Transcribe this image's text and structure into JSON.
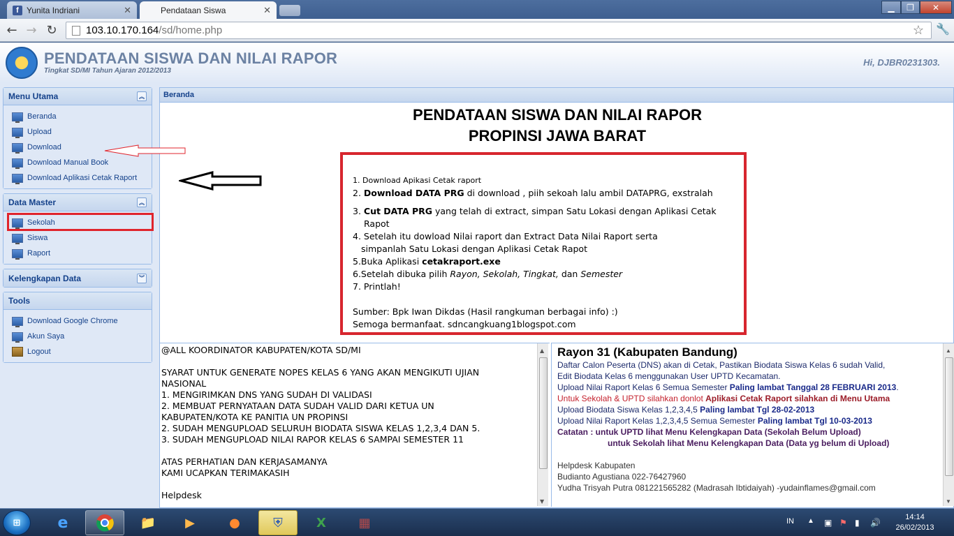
{
  "browser": {
    "tabs": [
      {
        "label": "Yunita Indriani",
        "icon": "facebook-icon"
      },
      {
        "label": "Pendataan Siswa",
        "icon": "page-icon"
      }
    ],
    "url_host": "103.10.170.164",
    "url_path": "/sd/home.php"
  },
  "header": {
    "title": "PENDATAAN SISWA DAN NILAI RAPOR",
    "subtitle": "Tingkat SD/MI Tahun Ajaran 2012/2013",
    "greeting": "Hi, DJBR0231303."
  },
  "sidebar": {
    "panels": [
      {
        "title": "Menu Utama",
        "items": [
          "Beranda",
          "Upload",
          "Download",
          "Download Manual Book",
          "Download Aplikasi Cetak Raport"
        ]
      },
      {
        "title": "Data Master",
        "items": [
          "Sekolah",
          "Siswa",
          "Raport"
        ]
      },
      {
        "title": "Kelengkapan Data",
        "items": []
      },
      {
        "title": "Tools",
        "items": [
          "Download Google Chrome",
          "Akun Saya",
          "Logout"
        ]
      }
    ]
  },
  "main": {
    "tab_title": "Beranda",
    "hero_line1": "PENDATAAN SISWA DAN NILAI RAPOR",
    "hero_line2": "PROPINSI JAWA BARAT",
    "instructions": {
      "l1": "1. Download Apikasi Cetak raport",
      "l2_num": "2. ",
      "l2_bold": "Download DATA PRG",
      "l2_rest": " di  download , piih sekoah lalu ambil  DATAPRG, exstralah",
      "l3_num": "3. ",
      "l3_bold": "Cut DATA PRG",
      "l3_rest": " yang telah di extract, simpan Satu Lokasi dengan Aplikasi Cetak",
      "l3_cont": "Rapot",
      "l4": "4. Setelah itu dowload Nilai raport dan Extract Data Nilai Raport serta",
      "l4_cont": "simpanlah Satu Lokasi dengan Aplikasi Cetak Rapot",
      "l5_pre": "5.Buka Aplikasi ",
      "l5_bold": "cetakraport.exe",
      "l6_pre": "6.Setelah dibuka pilih ",
      "l6_i1": "Rayon, Sekolah, Tingkat,",
      "l6_mid": " dan ",
      "l6_i2": "Semester",
      "l7": "7. Printlah!",
      "source": "Sumber: Bpk Iwan Dikdas (Hasil rangkuman berbagai info) :)",
      "closing": "Semoga bermanfaat.   sdncangkuang1blogspot.com"
    },
    "left_notice": [
      "@ALL KOORDINATOR KABUPATEN/KOTA SD/MI",
      "",
      "SYARAT UNTUK GENERATE NOPES KELAS 6 YANG AKAN MENGIKUTI UJIAN",
      "NASIONAL",
      "1. MENGIRIMKAN DNS YANG SUDAH DI VALIDASI",
      "2. MEMBUAT PERNYATAAN DATA SUDAH VALID DARI KETUA UN",
      "KABUPATEN/KOTA KE PANITIA UN PROPINSI",
      "2. SUDAH MENGUPLOAD SELURUH BIODATA SISWA KELAS 1,2,3,4 DAN 5.",
      "3. SUDAH MENGUPLOAD NILAI RAPOR KELAS 6 SAMPAI SEMESTER 11",
      "",
      "ATAS PERHATIAN DAN KERJASAMANYA",
      "KAMI UCAPKAN TERIMAKASIH",
      "",
      "Helpdesk"
    ],
    "right_notice": {
      "title": "Rayon 31 (Kabupaten Bandung)",
      "p1": "Daftar Calon Peserta (DNS) akan di Cetak, Pastikan Biodata Siswa Kelas 6 sudah Valid,",
      "p2": "Edit Biodata Kelas 6 menggunakan User UPTD Kecamatan.",
      "p3_pre": "Upload Nilai Raport Kelas 6 Semua Semester ",
      "p3_bold": "Paling lambat Tanggal 28 FEBRUARI 2013",
      "p3_end": ".",
      "p4_pre": "Untuk Sekolah & UPTD silahkan donlot ",
      "p4_bold": "Aplikasi Cetak Raport silahkan di Menu Utama",
      "p5_pre": "Upload Biodata Siswa Kelas 1,2,3,4,5 ",
      "p5_bold": "Paling lambat Tgl 28-02-2013",
      "p6_pre": "Upload Nilai Raport Kelas 1,2,3,4,5 Semua Semester ",
      "p6_bold": "Paling lambat Tgl 10-03-2013",
      "p7": "Catatan :   untuk UPTD lihat Menu Kelengkapan Data (Sekolah Belum Upload)",
      "p8": "untuk Sekolah lihat Menu Kelengkapan Data (Data yg belum di Upload)",
      "helpdesk": "Helpdesk Kabupaten",
      "h1": "Budianto Agustiana 022-76427960",
      "h2": "Yudha Trisyah Putra 081221565282 (Madrasah Ibtidaiyah) -yudainflames@gmail.com"
    }
  },
  "taskbar": {
    "language": "IN",
    "time": "14:14",
    "date": "26/02/2013"
  },
  "colors": {
    "accent": "#15428b",
    "highlight": "#e0242c"
  }
}
